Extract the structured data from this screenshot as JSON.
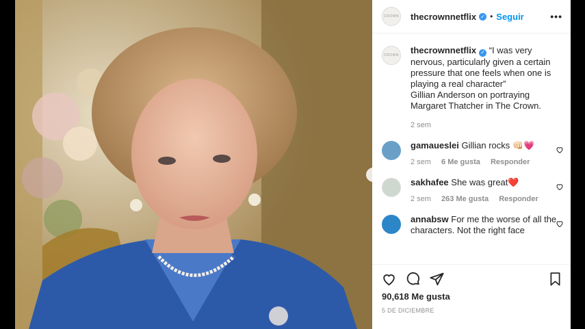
{
  "post": {
    "username": "thecrownnetflix",
    "verified_icon": "verified-badge-icon",
    "separator": "•",
    "follow_label": "Seguir",
    "more_label": "•••",
    "avatar_text": "CROWN",
    "next_label": "›"
  },
  "caption": {
    "username": "thecrownnetflix",
    "text_line1": "“I was very nervous, particularly given a certain pressure that one feels when one is playing a real character”",
    "text_line2": "Gillian Anderson on portraying Margaret Thatcher in The Crown.",
    "time": "2 sem"
  },
  "comments": [
    {
      "username": "gamaueslei",
      "text": "Gillian rocks 👊🏻💗",
      "time": "2 sem",
      "likes": "6 Me gusta",
      "reply": "Responder"
    },
    {
      "username": "sakhafee",
      "text": "She was great❤️",
      "time": "2 sem",
      "likes": "263 Me gusta",
      "reply": "Responder"
    },
    {
      "username": "annabsw",
      "text": "For me the worse of all the characters. Not the right face"
    }
  ],
  "footer": {
    "likes": "90,618 Me gusta",
    "date": "5 DE DICIEMBRE"
  },
  "colors": {
    "accent": "#0095f6",
    "verified": "#3897f0",
    "muted": "#8e8e8e",
    "suit_blue": "#2d5aa8"
  }
}
